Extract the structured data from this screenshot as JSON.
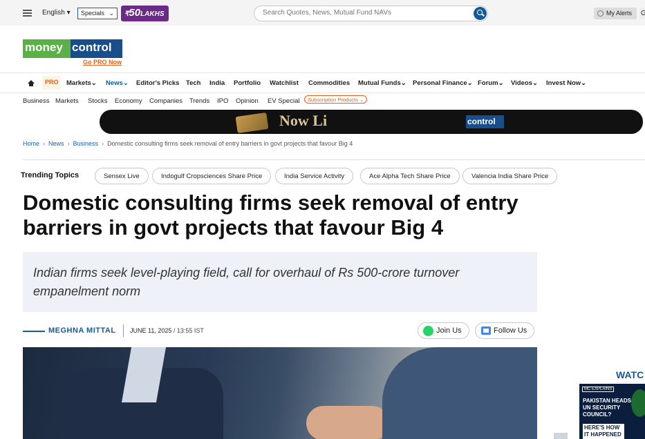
{
  "topbar": {
    "language": "English",
    "specials": "Specials",
    "promo": {
      "rupee": "₹",
      "amount": "50",
      "unit": "LAKHS"
    },
    "search_placeholder": "Search Quotes, News, Mutual Fund NAVs",
    "alerts": "My Alerts",
    "cut_text": "G"
  },
  "brand": {
    "logo_left": "money",
    "logo_right": "control",
    "gopro": "Go PRO Now"
  },
  "nav": {
    "pro": "PRO",
    "items": [
      "Markets",
      "News",
      "Editor's Picks",
      "Tech",
      "India",
      "Portfolio",
      "Watchlist",
      "Commodities",
      "Mutual Funds",
      "Personal Finance",
      "Forum",
      "Videos",
      "Invest Now"
    ]
  },
  "subnav": {
    "items": [
      "Business",
      "Markets",
      "Stocks",
      "Economy",
      "Companies",
      "Trends",
      "IPO",
      "Opinion",
      "EV Special"
    ],
    "badge": "Subscription Products"
  },
  "banner": {
    "text": "Now Li",
    "brand": "control"
  },
  "breadcrumb": [
    "Home",
    "News",
    "Business",
    "Domestic consulting firms seek removal of entry barriers in govt projects that favour Big 4"
  ],
  "trending": {
    "label": "Trending Topics",
    "chips": [
      "Sensex Live",
      "Indogulf Cropsciences Share Price",
      "India Service Activity",
      "Ace Alpha Tech Share Price",
      "Valencia India Share Price"
    ]
  },
  "article": {
    "headline": "Domestic consulting firms seek removal of entry barriers in govt projects that favour Big 4",
    "summary": "Indian firms seek level-playing field, call for overhaul of Rs 500-crore turnover empanelment norm",
    "author": "MEGHNA MITTAL",
    "date": "JUNE 11, 2025",
    "time": "/ 13:55 IST",
    "join_us": "Join Us",
    "follow_us": "Follow Us"
  },
  "sidebar": {
    "watch_title": "WATC",
    "video_tag": "MC EXPLAINS",
    "video_text": "PAKISTAN HEADS UN SECURITY COUNCIL?",
    "video_text2": "HERE'S HOW IT HAPPENED"
  }
}
